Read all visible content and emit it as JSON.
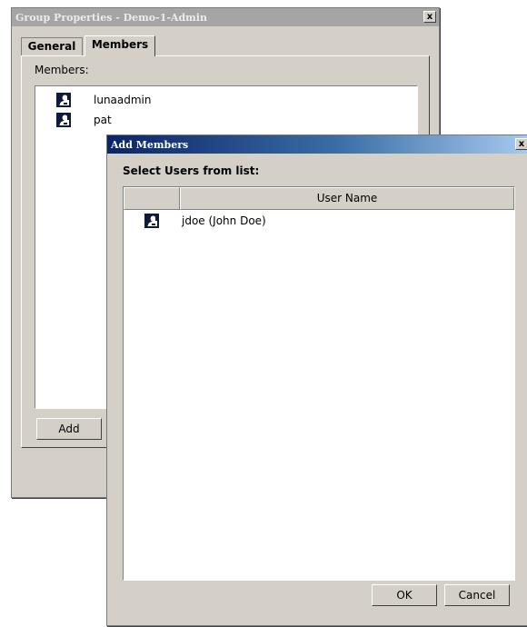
{
  "group_window": {
    "title": "Group Properties - Demo-1-Admin",
    "close_glyph": "x",
    "tabs": [
      {
        "label": "General",
        "selected": false
      },
      {
        "label": "Members",
        "selected": true
      }
    ],
    "members_label": "Members:",
    "members": [
      {
        "name": "lunaadmin",
        "icon": "user-icon"
      },
      {
        "name": "pat",
        "icon": "user-icon"
      }
    ],
    "add_button_label": "Add"
  },
  "add_members_dialog": {
    "title": "Add Members",
    "close_glyph": "x",
    "prompt": "Select Users from list:",
    "columns": [
      "",
      "User Name"
    ],
    "users": [
      {
        "name": "jdoe (John Doe)",
        "icon": "user-icon"
      }
    ],
    "ok_label": "OK",
    "cancel_label": "Cancel"
  },
  "colors": {
    "dialog_face": "#d4d0c8",
    "inactive_title": "#a5a5a5",
    "active_title_start": "#0a246a",
    "active_title_end": "#a6caf0",
    "icon_dark": "#0f1a3a"
  }
}
